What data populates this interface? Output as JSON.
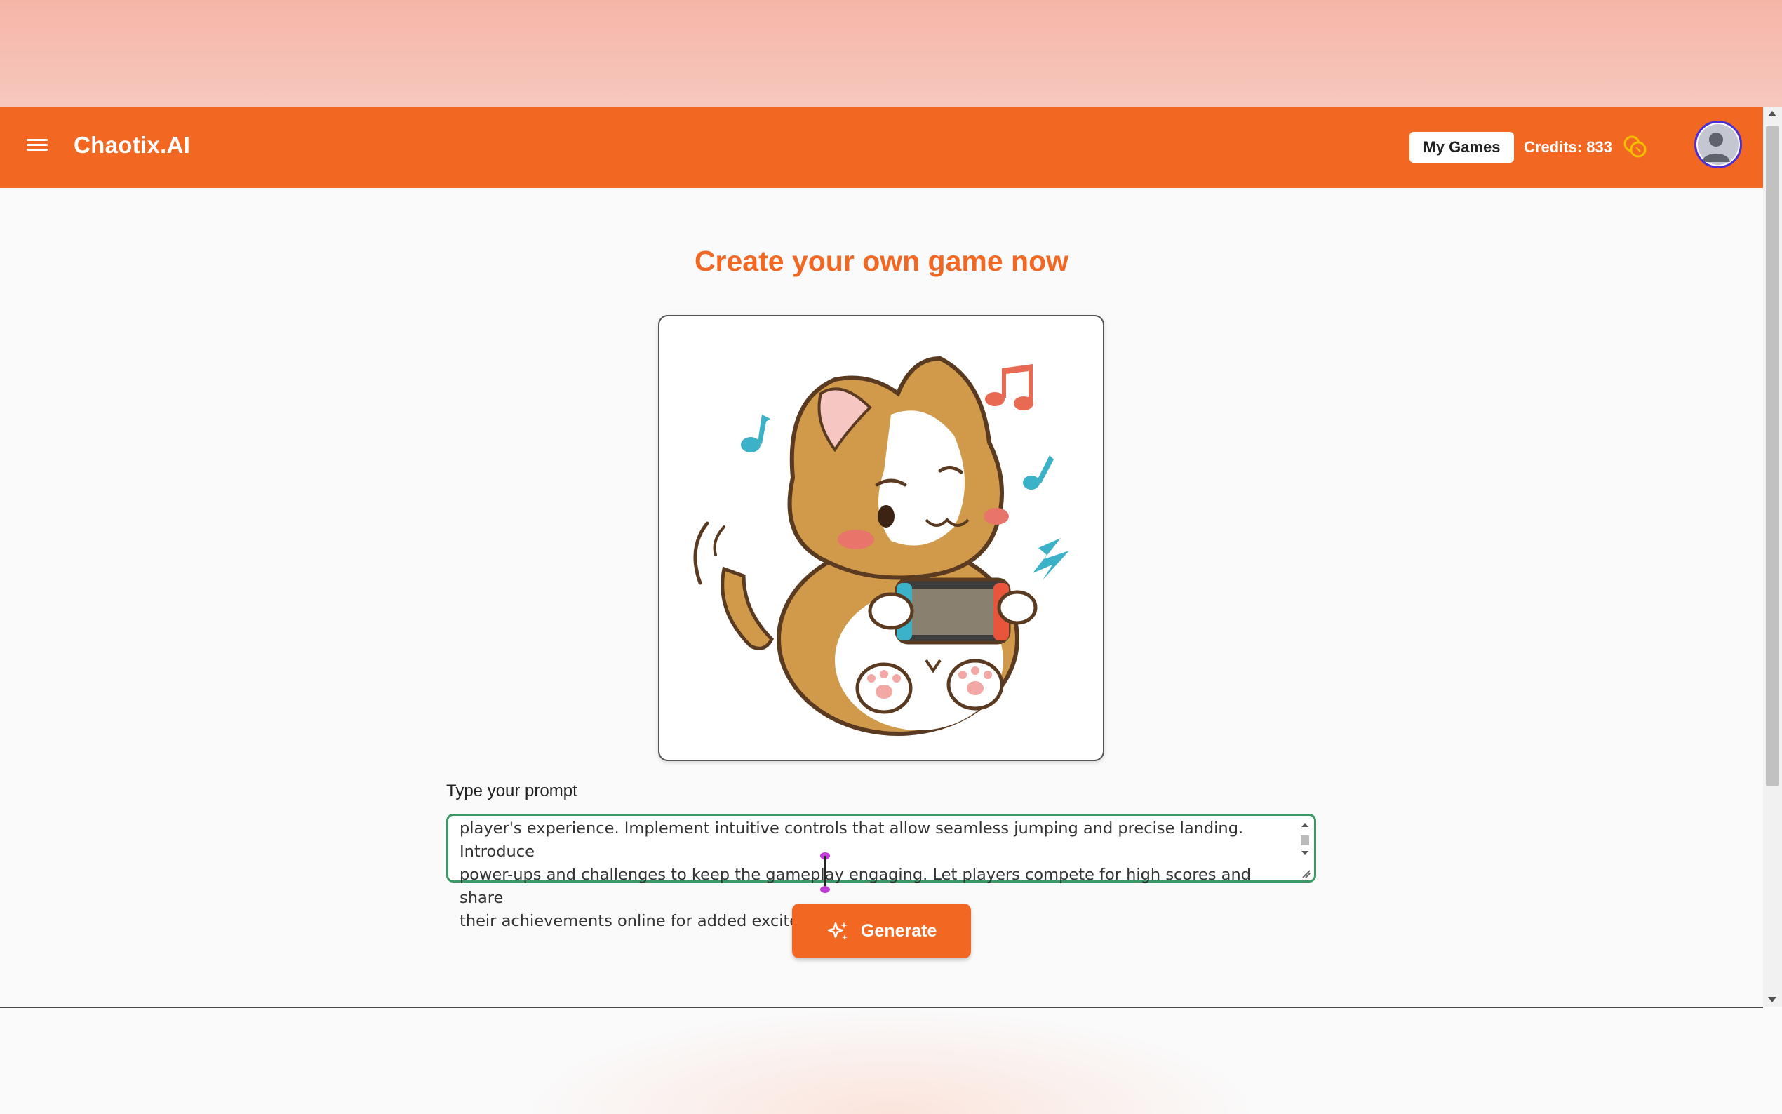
{
  "header": {
    "brand": "Chaotix.AI",
    "my_games_label": "My Games",
    "credits_text": "Credits: 833",
    "icons": {
      "menu": "hamburger-menu-icon",
      "coins": "coins-icon",
      "avatar": "user-avatar-icon"
    }
  },
  "main": {
    "title": "Create your own game now",
    "prompt_label": "Type your prompt",
    "prompt_lines": [
      "player's experience. Implement intuitive controls that allow seamless jumping and precise landing. Introduce",
      "power-ups and challenges to keep the gameplay engaging. Let players compete for high scores and share",
      "their achievements online for added excitement"
    ],
    "generate_label": "Generate",
    "generate_icon": "sparkles-icon"
  },
  "colors": {
    "brand_orange": "#f26722",
    "avatar_ring": "#4b2fd6",
    "coin": "#f2c200",
    "focus_border": "#3a9a63"
  }
}
